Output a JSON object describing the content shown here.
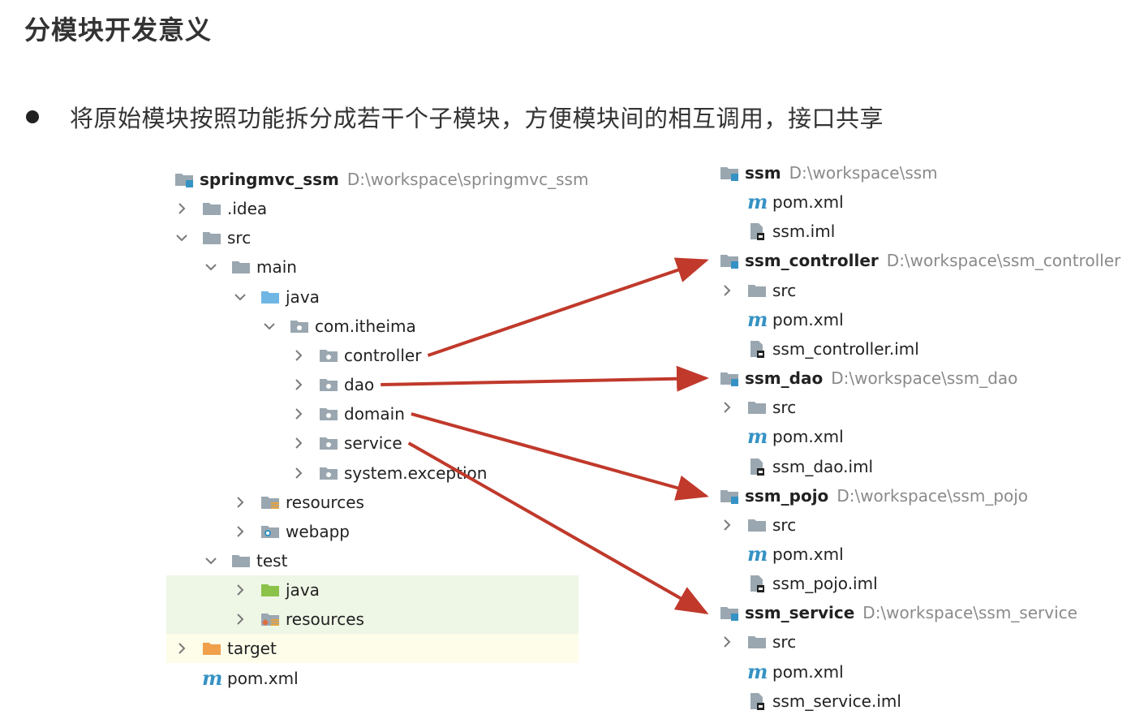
{
  "title": "分模块开发意义",
  "bullet": "将原始模块按照功能拆分成若干个子模块，方便模块间的相互调用，接口共享",
  "left_tree": [
    {
      "label": "springmvc_ssm",
      "path": "D:\\workspace\\springmvc_ssm",
      "icon": "module-folder-icon",
      "bold": true,
      "indent": 0,
      "chevron": "none"
    },
    {
      "label": ".idea",
      "icon": "folder-icon",
      "indent": 0,
      "chevron": "right"
    },
    {
      "label": "src",
      "icon": "folder-icon",
      "indent": 0,
      "chevron": "down"
    },
    {
      "label": "main",
      "icon": "folder-icon",
      "indent": 1,
      "chevron": "down"
    },
    {
      "label": "java",
      "icon": "source-folder-icon",
      "indent": 2,
      "chevron": "down"
    },
    {
      "label": "com.itheima",
      "icon": "package-icon",
      "indent": 3,
      "chevron": "down"
    },
    {
      "label": "controller",
      "icon": "package-icon",
      "indent": 4,
      "chevron": "right"
    },
    {
      "label": "dao",
      "icon": "package-icon",
      "indent": 4,
      "chevron": "right"
    },
    {
      "label": "domain",
      "icon": "package-icon",
      "indent": 4,
      "chevron": "right"
    },
    {
      "label": "service",
      "icon": "package-icon",
      "indent": 4,
      "chevron": "right"
    },
    {
      "label": "system.exception",
      "icon": "package-icon",
      "indent": 4,
      "chevron": "right"
    },
    {
      "label": "resources",
      "icon": "resources-folder-icon",
      "indent": 2,
      "chevron": "right"
    },
    {
      "label": "webapp",
      "icon": "web-folder-icon",
      "indent": 2,
      "chevron": "right"
    },
    {
      "label": "test",
      "icon": "folder-icon",
      "indent": 1,
      "chevron": "down"
    },
    {
      "label": "java",
      "icon": "test-folder-icon",
      "indent": 2,
      "chevron": "right"
    },
    {
      "label": "resources",
      "icon": "test-resources-folder-icon",
      "indent": 2,
      "chevron": "right"
    },
    {
      "label": "target",
      "icon": "excluded-folder-icon",
      "indent": 0,
      "chevron": "right"
    },
    {
      "label": "pom.xml",
      "icon": "maven-icon",
      "indent": 0,
      "chevron": "none"
    }
  ],
  "right_tree": [
    {
      "label": "ssm",
      "path": "D:\\workspace\\ssm",
      "icon": "module-folder-icon",
      "bold": true,
      "level": 0,
      "chevron": "none"
    },
    {
      "label": "pom.xml",
      "icon": "maven-icon",
      "level": 1,
      "chevron": "none"
    },
    {
      "label": "ssm.iml",
      "icon": "iml-file-icon",
      "level": 1,
      "chevron": "none"
    },
    {
      "label": "ssm_controller",
      "path": "D:\\workspace\\ssm_controller",
      "icon": "module-folder-icon",
      "bold": true,
      "level": 0,
      "chevron": "none"
    },
    {
      "label": "src",
      "icon": "folder-icon",
      "level": 1,
      "chevron": "right"
    },
    {
      "label": "pom.xml",
      "icon": "maven-icon",
      "level": 1,
      "chevron": "none"
    },
    {
      "label": "ssm_controller.iml",
      "icon": "iml-file-icon",
      "level": 1,
      "chevron": "none"
    },
    {
      "label": "ssm_dao",
      "path": "D:\\workspace\\ssm_dao",
      "icon": "module-folder-icon",
      "bold": true,
      "level": 0,
      "chevron": "none"
    },
    {
      "label": "src",
      "icon": "folder-icon",
      "level": 1,
      "chevron": "right"
    },
    {
      "label": "pom.xml",
      "icon": "maven-icon",
      "level": 1,
      "chevron": "none"
    },
    {
      "label": "ssm_dao.iml",
      "icon": "iml-file-icon",
      "level": 1,
      "chevron": "none"
    },
    {
      "label": "ssm_pojo",
      "path": "D:\\workspace\\ssm_pojo",
      "icon": "module-folder-icon",
      "bold": true,
      "level": 0,
      "chevron": "none"
    },
    {
      "label": "src",
      "icon": "folder-icon",
      "level": 1,
      "chevron": "right"
    },
    {
      "label": "pom.xml",
      "icon": "maven-icon",
      "level": 1,
      "chevron": "none"
    },
    {
      "label": "ssm_pojo.iml",
      "icon": "iml-file-icon",
      "level": 1,
      "chevron": "none"
    },
    {
      "label": "ssm_service",
      "path": "D:\\workspace\\ssm_service",
      "icon": "module-folder-icon",
      "bold": true,
      "level": 0,
      "chevron": "none"
    },
    {
      "label": "src",
      "icon": "folder-icon",
      "level": 1,
      "chevron": "right"
    },
    {
      "label": "pom.xml",
      "icon": "maven-icon",
      "level": 1,
      "chevron": "none"
    },
    {
      "label": "ssm_service.iml",
      "icon": "iml-file-icon",
      "level": 1,
      "chevron": "none"
    }
  ],
  "arrows": [
    {
      "from": "controller",
      "to": "ssm_controller"
    },
    {
      "from": "dao",
      "to": "ssm_dao"
    },
    {
      "from": "domain",
      "to": "ssm_pojo"
    },
    {
      "from": "service",
      "to": "ssm_service"
    }
  ],
  "colors": {
    "arrow": "#c0392b",
    "path_text": "#8a8a8a",
    "highlight_test": "#eef6e6",
    "highlight_target": "#fdfde9"
  }
}
